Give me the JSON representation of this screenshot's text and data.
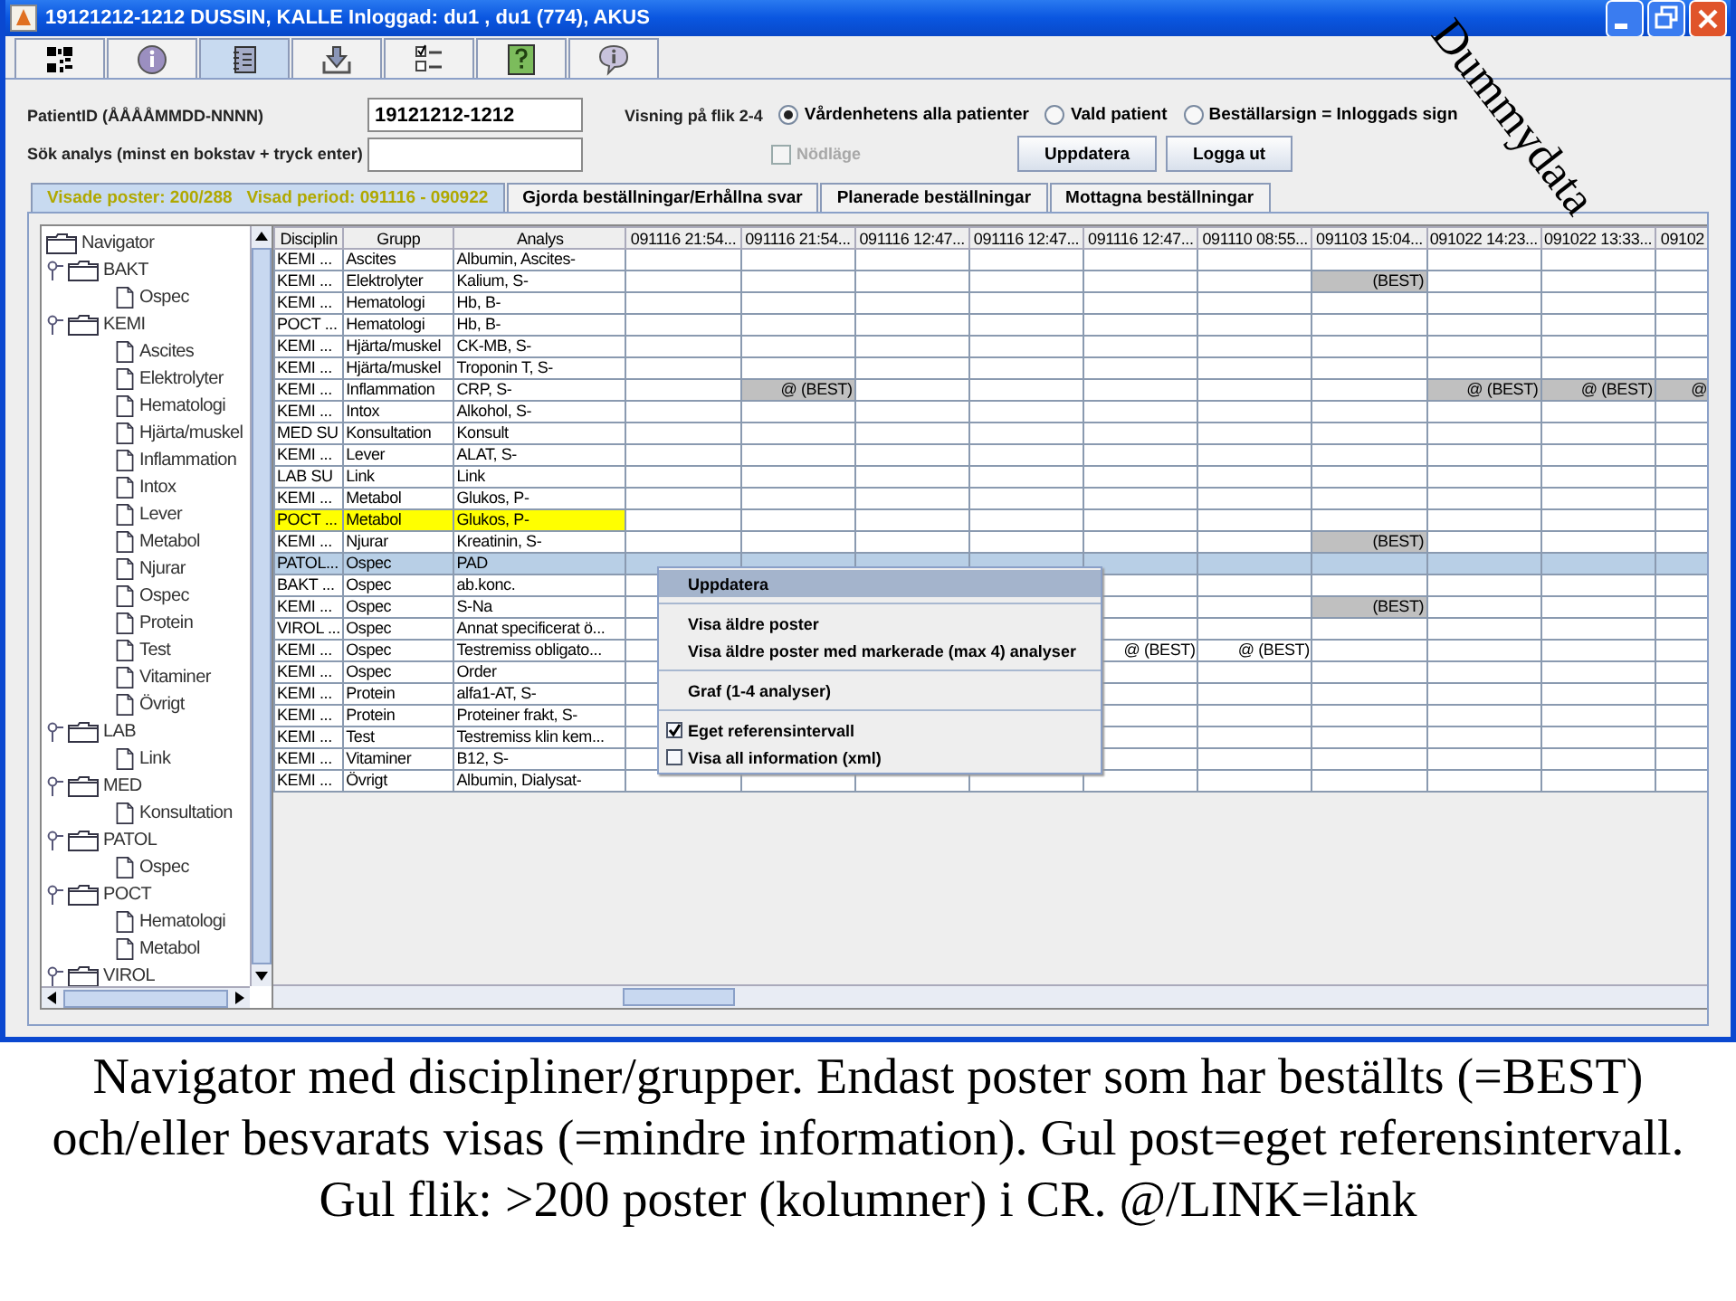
{
  "window": {
    "title": "19121212-1212 DUSSIN, KALLE   Inloggad: du1 , du1 (774), AKUS"
  },
  "icon_tabs": [
    {
      "kind": "qr",
      "selected": false
    },
    {
      "kind": "info",
      "selected": false
    },
    {
      "kind": "notebook",
      "selected": true
    },
    {
      "kind": "download",
      "selected": false
    },
    {
      "kind": "checklist",
      "selected": false
    },
    {
      "kind": "help",
      "selected": false
    },
    {
      "kind": "chat",
      "selected": false
    }
  ],
  "form": {
    "patient_label": "PatientID (ÅÅÅÅMMDD-NNNN)",
    "patient_value": "19121212-1212",
    "search_label": "Sök analys (minst en bokstav + tryck enter)",
    "view_label": "Visning på flik 2-4",
    "radios": [
      {
        "label": "Vårdenhetens alla patienter",
        "selected": true
      },
      {
        "label": "Vald patient",
        "selected": false
      },
      {
        "label": "Beställarsign = Inloggads sign",
        "selected": false
      }
    ],
    "emergency": {
      "label": "Nödläge",
      "checked": false,
      "disabled": true
    },
    "buttons": [
      "Uppdatera",
      "Logga ut"
    ]
  },
  "tabs": [
    {
      "label": "Visade poster: 200/288   Visad period: 091116 - 090922",
      "selected": true
    },
    {
      "label": "Gjorda beställningar/Erhållna svar",
      "selected": false
    },
    {
      "label": "Planerade beställningar",
      "selected": false
    },
    {
      "label": "Mottagna beställningar",
      "selected": false
    }
  ],
  "navigator": {
    "label": "Navigator",
    "children": [
      {
        "label": "BAKT",
        "children": [
          {
            "label": "Ospec"
          }
        ]
      },
      {
        "label": "KEMI",
        "children": [
          {
            "label": "Ascites"
          },
          {
            "label": "Elektrolyter"
          },
          {
            "label": "Hematologi"
          },
          {
            "label": "Hjärta/muskel"
          },
          {
            "label": "Inflammation"
          },
          {
            "label": "Intox"
          },
          {
            "label": "Lever"
          },
          {
            "label": "Metabol"
          },
          {
            "label": "Njurar"
          },
          {
            "label": "Ospec"
          },
          {
            "label": "Protein"
          },
          {
            "label": "Test"
          },
          {
            "label": "Vitaminer"
          },
          {
            "label": "Övrigt"
          }
        ]
      },
      {
        "label": "LAB",
        "children": [
          {
            "label": "Link"
          }
        ]
      },
      {
        "label": "MED",
        "children": [
          {
            "label": "Konsultation"
          }
        ]
      },
      {
        "label": "PATOL",
        "children": [
          {
            "label": "Ospec"
          }
        ]
      },
      {
        "label": "POCT",
        "children": [
          {
            "label": "Hematologi"
          },
          {
            "label": "Metabol"
          }
        ]
      },
      {
        "label": "VIROL"
      }
    ]
  },
  "table": {
    "columns": [
      "Disciplin",
      "Grupp",
      "Analys"
    ],
    "date_columns": [
      "091116 21:54...",
      "091116 21:54...",
      "091116 12:47...",
      "091116 12:47...",
      "091116 12:47...",
      "091110 08:55...",
      "091103 15:04...",
      "091022 14:23...",
      "091022 13:33...",
      "09102"
    ],
    "rows": [
      {
        "disciplin": "KEMI ...",
        "grupp": "Ascites",
        "analys": "Albumin, Ascites-",
        "own_reference": false,
        "selected": false,
        "cells": [
          null,
          null,
          null,
          null,
          null,
          null,
          null,
          null,
          null,
          null
        ]
      },
      {
        "disciplin": "KEMI ...",
        "grupp": "Elektrolyter",
        "analys": "Kalium, S-",
        "own_reference": false,
        "selected": false,
        "cells": [
          null,
          null,
          null,
          null,
          null,
          null,
          {
            "text": "(BEST)",
            "shaded": true
          },
          null,
          null,
          null
        ]
      },
      {
        "disciplin": "KEMI ...",
        "grupp": "Hematologi",
        "analys": "Hb, B-",
        "own_reference": false,
        "selected": false,
        "cells": [
          null,
          null,
          null,
          null,
          null,
          null,
          null,
          null,
          null,
          null
        ]
      },
      {
        "disciplin": "POCT ...",
        "grupp": "Hematologi",
        "analys": "Hb, B-",
        "own_reference": false,
        "selected": false,
        "cells": [
          null,
          null,
          null,
          null,
          null,
          null,
          null,
          null,
          null,
          null
        ]
      },
      {
        "disciplin": "KEMI ...",
        "grupp": "Hjärta/muskel",
        "analys": "CK-MB, S-",
        "own_reference": false,
        "selected": false,
        "cells": [
          null,
          null,
          null,
          null,
          null,
          null,
          null,
          null,
          null,
          null
        ]
      },
      {
        "disciplin": "KEMI ...",
        "grupp": "Hjärta/muskel",
        "analys": "Troponin T, S-",
        "own_reference": false,
        "selected": false,
        "cells": [
          null,
          null,
          null,
          null,
          null,
          null,
          null,
          null,
          null,
          null
        ]
      },
      {
        "disciplin": "KEMI ...",
        "grupp": "Inflammation",
        "analys": "CRP, S-",
        "own_reference": false,
        "selected": false,
        "cells": [
          null,
          {
            "text": "@ (BEST)",
            "shaded": true
          },
          null,
          null,
          null,
          null,
          null,
          {
            "text": "@ (BEST)",
            "shaded": true
          },
          {
            "text": "@ (BEST)",
            "shaded": true
          },
          {
            "text": "@",
            "shaded": true
          }
        ]
      },
      {
        "disciplin": "KEMI ...",
        "grupp": "Intox",
        "analys": "Alkohol, S-",
        "own_reference": false,
        "selected": false,
        "cells": [
          null,
          null,
          null,
          null,
          null,
          null,
          null,
          null,
          null,
          null
        ]
      },
      {
        "disciplin": "MED SU",
        "grupp": "Konsultation",
        "analys": "Konsult",
        "own_reference": false,
        "selected": false,
        "cells": [
          null,
          null,
          null,
          null,
          null,
          null,
          null,
          null,
          null,
          null
        ]
      },
      {
        "disciplin": "KEMI ...",
        "grupp": "Lever",
        "analys": "ALAT, S-",
        "own_reference": false,
        "selected": false,
        "cells": [
          null,
          null,
          null,
          null,
          null,
          null,
          null,
          null,
          null,
          null
        ]
      },
      {
        "disciplin": "LAB SU",
        "grupp": "Link",
        "analys": "Link",
        "own_reference": false,
        "selected": false,
        "cells": [
          null,
          null,
          null,
          null,
          null,
          null,
          null,
          null,
          null,
          null
        ]
      },
      {
        "disciplin": "KEMI ...",
        "grupp": "Metabol",
        "analys": "Glukos, P-",
        "own_reference": false,
        "selected": false,
        "cells": [
          null,
          null,
          null,
          null,
          null,
          null,
          null,
          null,
          null,
          null
        ]
      },
      {
        "disciplin": "POCT ...",
        "grupp": "Metabol",
        "analys": "Glukos, P-",
        "own_reference": true,
        "selected": false,
        "cells": [
          null,
          null,
          null,
          null,
          null,
          null,
          null,
          null,
          null,
          null
        ]
      },
      {
        "disciplin": "KEMI ...",
        "grupp": "Njurar",
        "analys": "Kreatinin, S-",
        "own_reference": false,
        "selected": false,
        "cells": [
          null,
          null,
          null,
          null,
          null,
          null,
          {
            "text": "(BEST)",
            "shaded": true
          },
          null,
          null,
          null
        ]
      },
      {
        "disciplin": "PATOL...",
        "grupp": "Ospec",
        "analys": "PAD",
        "own_reference": false,
        "selected": true,
        "cells": [
          null,
          null,
          null,
          null,
          null,
          null,
          null,
          null,
          null,
          null
        ]
      },
      {
        "disciplin": "BAKT ...",
        "grupp": "Ospec",
        "analys": "ab.konc.",
        "own_reference": false,
        "selected": false,
        "cells": [
          null,
          null,
          null,
          null,
          null,
          null,
          null,
          null,
          null,
          null
        ]
      },
      {
        "disciplin": "KEMI ...",
        "grupp": "Ospec",
        "analys": "S-Na",
        "own_reference": false,
        "selected": false,
        "cells": [
          null,
          null,
          null,
          null,
          null,
          null,
          {
            "text": "(BEST)",
            "shaded": true
          },
          null,
          null,
          null
        ]
      },
      {
        "disciplin": "VIROL ...",
        "grupp": "Ospec",
        "analys": "Annat specificerat ö...",
        "own_reference": false,
        "selected": false,
        "cells": [
          null,
          null,
          null,
          null,
          null,
          null,
          null,
          null,
          null,
          null
        ]
      },
      {
        "disciplin": "KEMI ...",
        "grupp": "Ospec",
        "analys": "Testremiss obligato...",
        "own_reference": false,
        "selected": false,
        "cells": [
          null,
          null,
          null,
          null,
          {
            "text": "@ (BEST)",
            "shaded": false
          },
          {
            "text": "@ (BEST)",
            "shaded": false
          },
          null,
          null,
          null,
          null
        ]
      },
      {
        "disciplin": "KEMI ...",
        "grupp": "Ospec",
        "analys": "Order",
        "own_reference": false,
        "selected": false,
        "cells": [
          null,
          null,
          null,
          null,
          null,
          null,
          null,
          null,
          null,
          null
        ]
      },
      {
        "disciplin": "KEMI ...",
        "grupp": "Protein",
        "analys": "alfa1-AT, S-",
        "own_reference": false,
        "selected": false,
        "cells": [
          null,
          null,
          null,
          null,
          null,
          null,
          null,
          null,
          null,
          null
        ]
      },
      {
        "disciplin": "KEMI ...",
        "grupp": "Protein",
        "analys": "Proteiner frakt, S-",
        "own_reference": false,
        "selected": false,
        "cells": [
          null,
          null,
          null,
          null,
          null,
          null,
          null,
          null,
          null,
          null
        ]
      },
      {
        "disciplin": "KEMI ...",
        "grupp": "Test",
        "analys": "Testremiss klin kem...",
        "own_reference": false,
        "selected": false,
        "cells": [
          null,
          null,
          null,
          null,
          null,
          null,
          null,
          null,
          null,
          null
        ]
      },
      {
        "disciplin": "KEMI ...",
        "grupp": "Vitaminer",
        "analys": "B12, S-",
        "own_reference": false,
        "selected": false,
        "cells": [
          null,
          null,
          null,
          null,
          null,
          null,
          null,
          null,
          null,
          null
        ]
      },
      {
        "disciplin": "KEMI ...",
        "grupp": "Övrigt",
        "analys": "Albumin, Dialysat-",
        "own_reference": false,
        "selected": false,
        "cells": [
          null,
          null,
          null,
          null,
          null,
          null,
          null,
          null,
          null,
          null
        ]
      }
    ]
  },
  "context_menu": [
    {
      "kind": "item",
      "label": "Uppdatera",
      "selected": true
    },
    {
      "kind": "separator"
    },
    {
      "kind": "item",
      "label": "Visa äldre poster",
      "selected": false
    },
    {
      "kind": "item",
      "label": "Visa äldre poster med markerade (max 4) analyser",
      "selected": false
    },
    {
      "kind": "separator"
    },
    {
      "kind": "item",
      "label": "Graf (1-4 analyser)",
      "selected": false
    },
    {
      "kind": "separator"
    },
    {
      "kind": "checkbox",
      "label": "Eget referensintervall",
      "checked": true,
      "selected": false
    },
    {
      "kind": "checkbox",
      "label": "Visa all information (xml)",
      "checked": false,
      "selected": false
    }
  ],
  "annotation": "Dummydata",
  "caption": "Navigator med discipliner/grupper. Endast poster som har beställts (=BEST) och/eller besvarats visas (=mindre information). Gul post=eget referensintervall. Gul flik: >200 poster (kolumner)  i CR. @/LINK=länk"
}
